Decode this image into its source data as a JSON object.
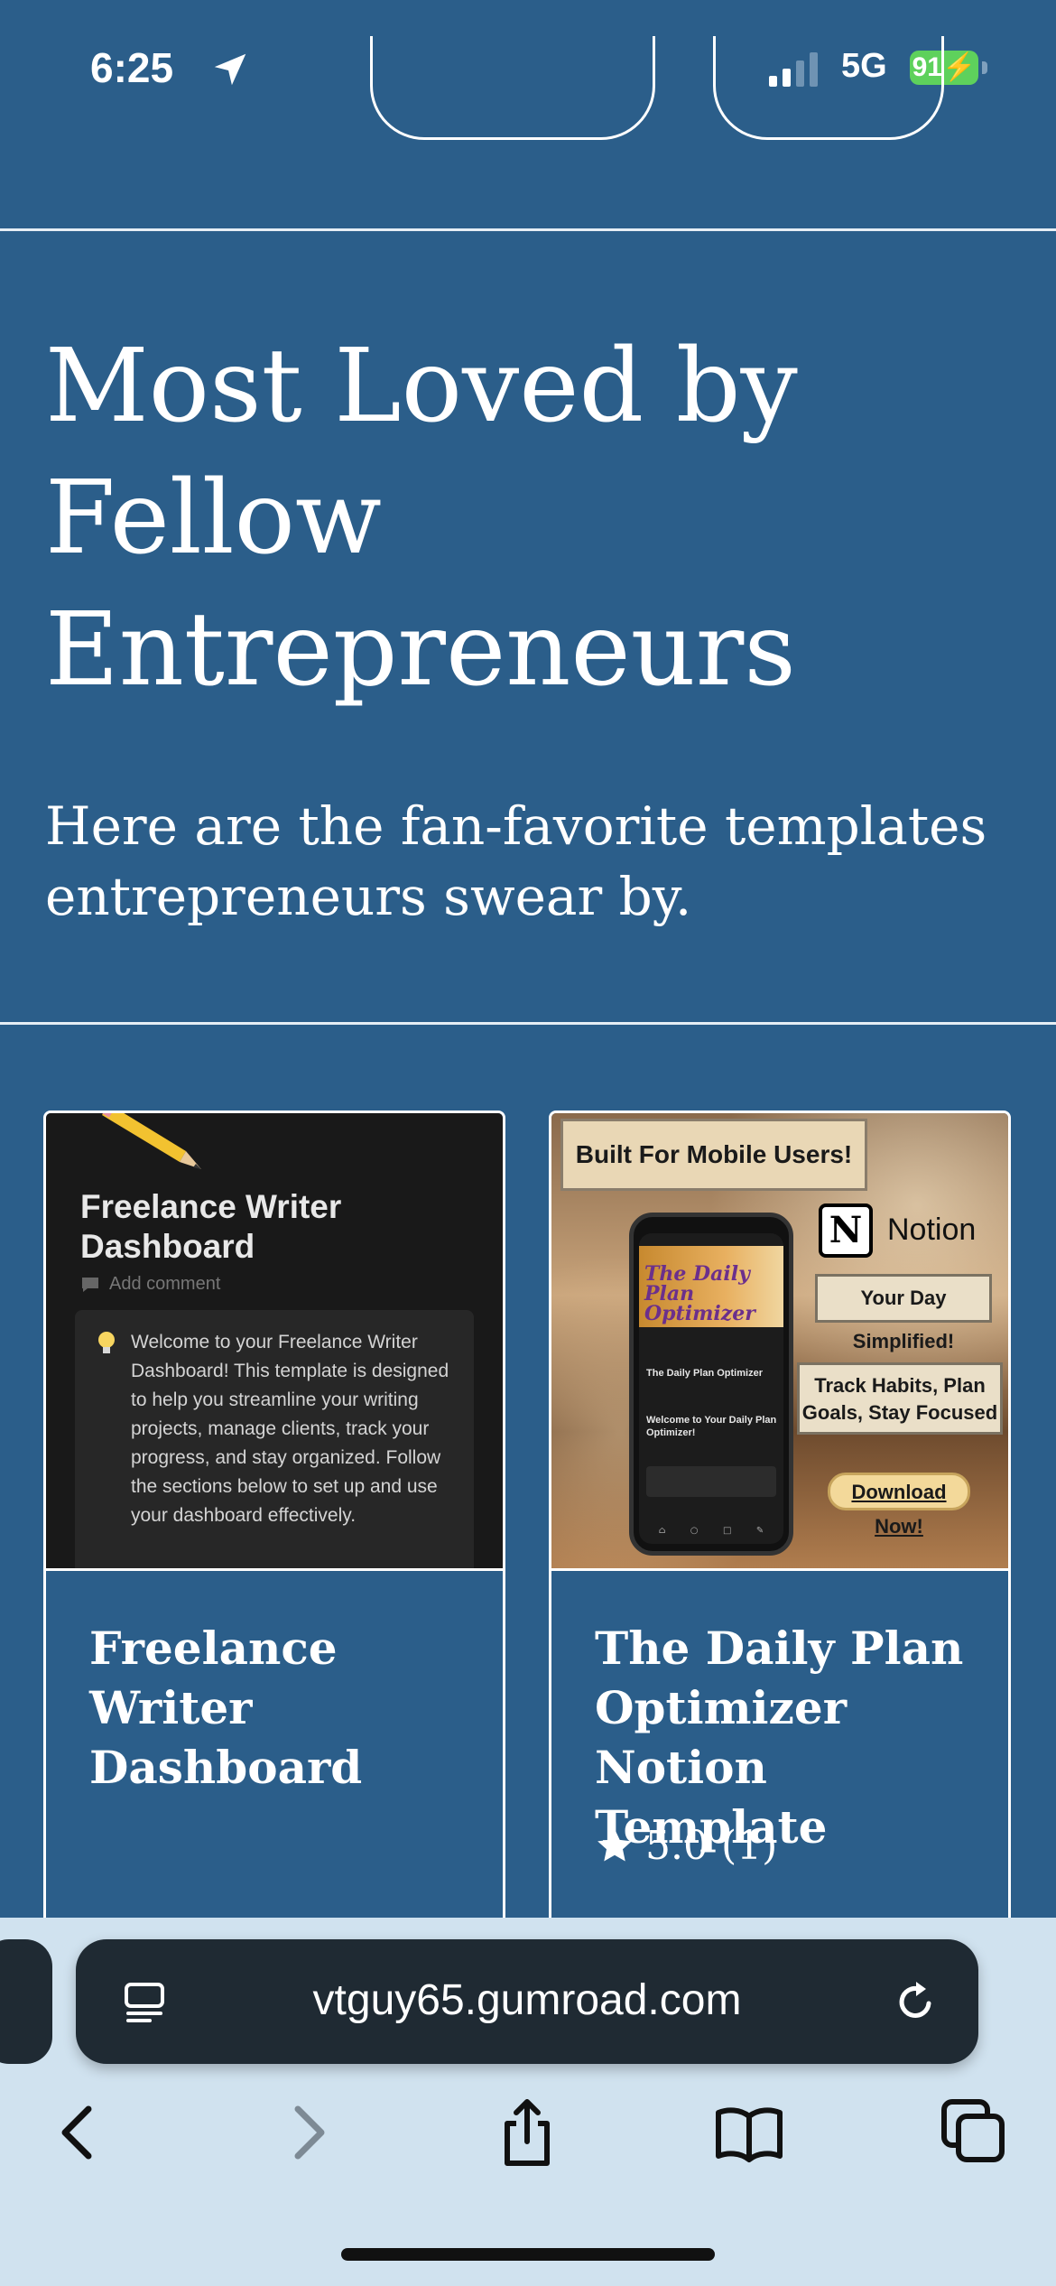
{
  "status": {
    "time": "6:25",
    "network": "5G",
    "battery": "91"
  },
  "hero": {
    "title": "Most Loved by Fellow Entrepreneurs",
    "subtitle": "Here are the fan-favorite templates entrepreneurs swear by."
  },
  "cards": [
    {
      "title": "Freelance Writer Dashboard",
      "thumb": {
        "heading": "Freelance Writer Dashboard",
        "comment": "Add comment",
        "body": "Welcome to your Freelance Writer Dashboard! This template is designed to help you streamline your writing projects, manage clients, track your progress, and stay organized. Follow the sections below to set up and use your dashboard effectively."
      }
    },
    {
      "title": "The Daily Plan Optimizer Notion Template",
      "rating": "5.0 (1)",
      "thumb": {
        "banner": "Built For Mobile Users!",
        "brand": "Notion",
        "tag1": "Your Day Simplified!",
        "tag2": "Track Habits, Plan Goals, Stay Focused",
        "cta": "Download Now!",
        "phone_art": "The Daily Plan Optimizer",
        "phone_heading": "The Daily Plan Optimizer",
        "phone_welcome": "Welcome to Your Daily Plan Optimizer!"
      }
    }
  ],
  "browser": {
    "url": "vtguy65.gumroad.com"
  },
  "colors": {
    "background": "#2b5e8a",
    "toolbar": "#d0e2ef",
    "url_bar": "#1f2a33"
  }
}
